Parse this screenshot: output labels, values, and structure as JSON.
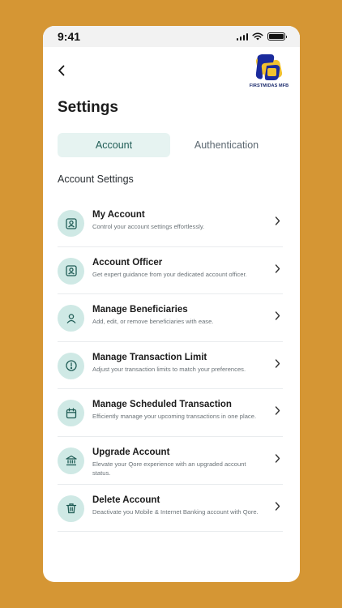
{
  "status": {
    "time": "9:41"
  },
  "brand": {
    "logo_text": "FIRSTMIDAS MFB"
  },
  "page": {
    "title": "Settings"
  },
  "tabs": [
    {
      "label": "Account",
      "active": true
    },
    {
      "label": "Authentication",
      "active": false
    }
  ],
  "section": {
    "title": "Account Settings"
  },
  "items": [
    {
      "title": "My Account",
      "desc": "Control your account settings effortlessly.",
      "icon": "user-card-icon"
    },
    {
      "title": "Account Officer",
      "desc": "Get expert guidance from your dedicated account officer.",
      "icon": "id-card-icon"
    },
    {
      "title": "Manage Beneficiaries",
      "desc": "Add, edit, or remove beneficiaries with ease.",
      "icon": "person-icon"
    },
    {
      "title": "Manage Transaction Limit",
      "desc": "Adjust your transaction limits to match your preferences.",
      "icon": "alert-circle-icon"
    },
    {
      "title": "Manage Scheduled Transaction",
      "desc": "Efficiently manage your upcoming transactions in one place.",
      "icon": "calendar-icon"
    },
    {
      "title": "Upgrade Account",
      "desc": "Elevate your Qore experience with an upgraded account status.",
      "icon": "bank-icon"
    },
    {
      "title": "Delete Account",
      "desc": "Deactivate you Mobile & Internet Banking account with Qore.",
      "icon": "trash-icon"
    }
  ],
  "colors": {
    "background": "#D59634",
    "accent": "#1F5C55",
    "icon_bg": "#CFE9E5",
    "tab_active_bg": "#E6F3F1"
  }
}
